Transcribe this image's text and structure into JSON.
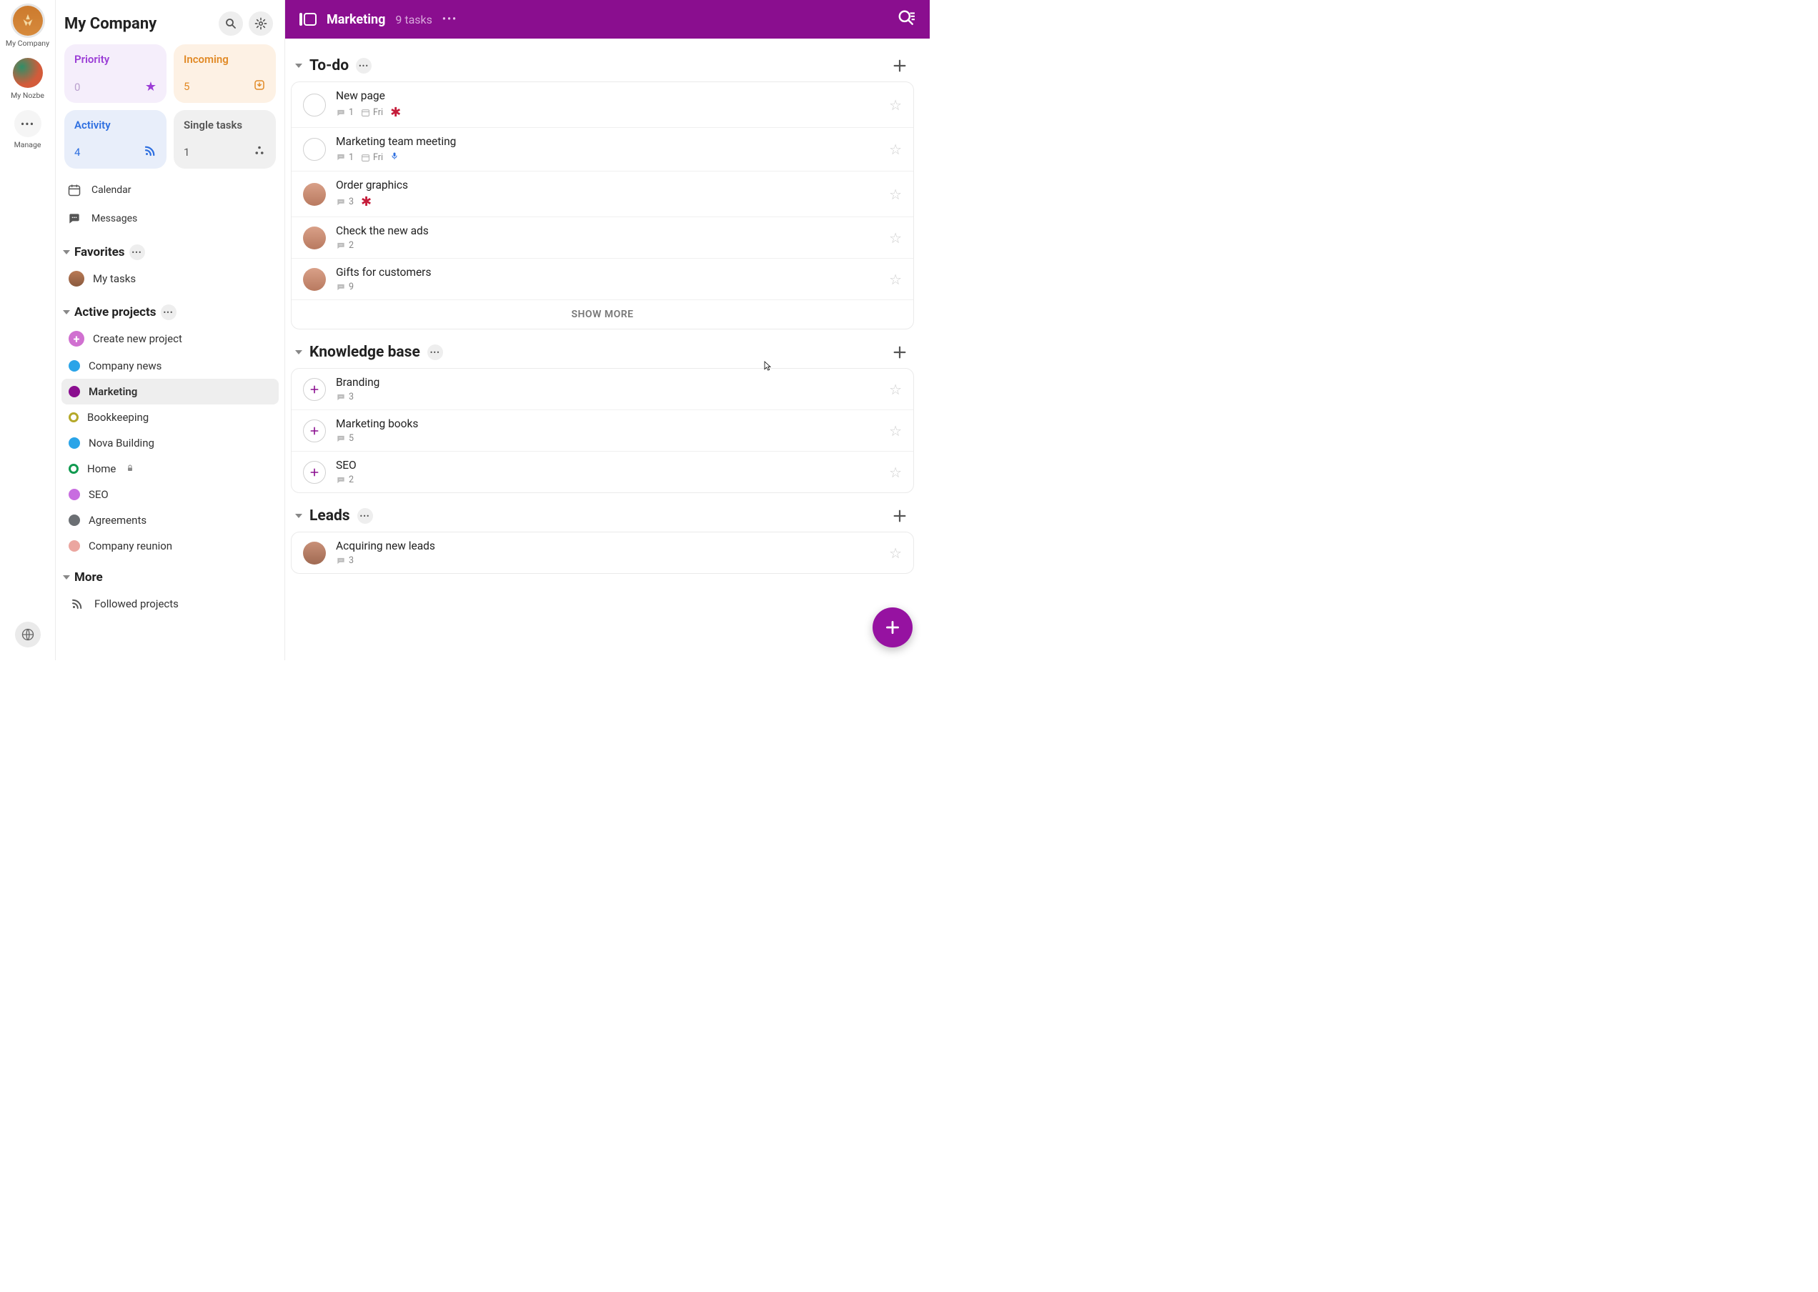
{
  "rail": {
    "company_label": "My Company",
    "nozbe_label": "My Nozbe",
    "manage_label": "Manage"
  },
  "sidebar": {
    "title": "My Company",
    "cards": {
      "priority": {
        "label": "Priority",
        "count": "0"
      },
      "incoming": {
        "label": "Incoming",
        "count": "5"
      },
      "activity": {
        "label": "Activity",
        "count": "4"
      },
      "single": {
        "label": "Single tasks",
        "count": "1"
      }
    },
    "links": {
      "calendar": "Calendar",
      "messages": "Messages"
    },
    "sections": {
      "favorites": "Favorites",
      "active": "Active projects",
      "more": "More"
    },
    "favorites": {
      "my_tasks": "My tasks"
    },
    "create": "Create new project",
    "projects": [
      {
        "label": "Company news",
        "color": "#2aa4e8",
        "style": "solid"
      },
      {
        "label": "Marketing",
        "color": "#8a0e8f",
        "style": "solid",
        "active": true
      },
      {
        "label": "Bookkeeping",
        "color": "#b5a92a",
        "style": "ring"
      },
      {
        "label": "Nova Building",
        "color": "#2aa4e8",
        "style": "solid"
      },
      {
        "label": "Home",
        "color": "#119a50",
        "style": "ring",
        "locked": true
      },
      {
        "label": "SEO",
        "color": "#c86de0",
        "style": "solid"
      },
      {
        "label": "Agreements",
        "color": "#6b6f73",
        "style": "solid"
      },
      {
        "label": "Company reunion",
        "color": "#eba6a0",
        "style": "solid"
      }
    ],
    "more_items": {
      "followed": "Followed projects"
    }
  },
  "topbar": {
    "project": "Marketing",
    "tasks": "9 tasks"
  },
  "groups": [
    {
      "name": "To-do",
      "tasks": [
        {
          "title": "New page",
          "kind": "check",
          "comments": "1",
          "due": "Fri",
          "red": true
        },
        {
          "title": "Marketing team meeting",
          "kind": "check",
          "comments": "1",
          "due": "Fri",
          "mic": true
        },
        {
          "title": "Order graphics",
          "kind": "avatar",
          "comments": "3",
          "red": true
        },
        {
          "title": "Check the new ads",
          "kind": "avatar",
          "comments": "2"
        },
        {
          "title": "Gifts for customers",
          "kind": "avatar",
          "comments": "9"
        }
      ],
      "show_more": "SHOW MORE"
    },
    {
      "name": "Knowledge base",
      "tasks": [
        {
          "title": "Branding",
          "kind": "plus",
          "comments": "3"
        },
        {
          "title": "Marketing books",
          "kind": "plus",
          "comments": "5"
        },
        {
          "title": "SEO",
          "kind": "plus",
          "comments": "2"
        }
      ]
    },
    {
      "name": "Leads",
      "tasks": [
        {
          "title": "Acquiring new leads",
          "kind": "avatar2",
          "comments": "3"
        }
      ]
    }
  ]
}
